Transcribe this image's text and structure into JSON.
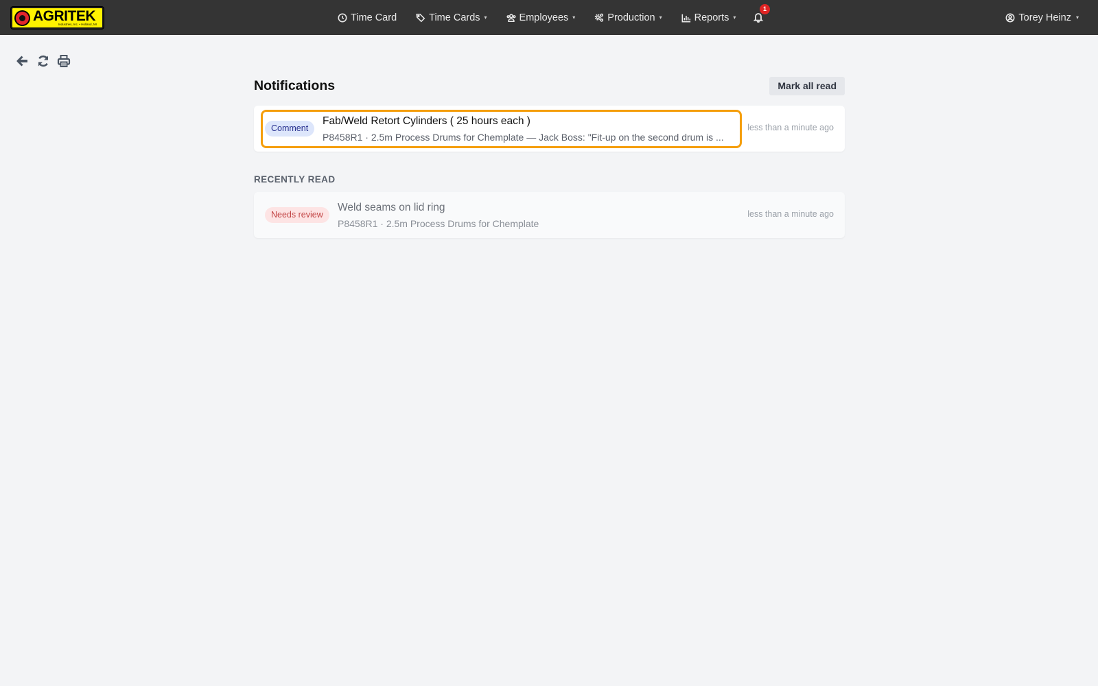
{
  "brand": {
    "logo_text": "AGRITEK",
    "logo_subtext": "Industries, Inc. • Holland, MI",
    "logo_bg": "#fff200"
  },
  "nav": {
    "items": [
      {
        "label": "Time Card",
        "icon": "clock-icon",
        "has_dropdown": false
      },
      {
        "label": "Time Cards",
        "icon": "tags-icon",
        "has_dropdown": true
      },
      {
        "label": "Employees",
        "icon": "users-icon",
        "has_dropdown": true
      },
      {
        "label": "Production",
        "icon": "gears-icon",
        "has_dropdown": true
      },
      {
        "label": "Reports",
        "icon": "bar-chart-icon",
        "has_dropdown": true
      }
    ],
    "caret": "▾",
    "notifications_count": "1",
    "user_name": "Torey Heinz"
  },
  "toolbar": {
    "icons": [
      "back-arrow-icon",
      "refresh-icon",
      "print-icon"
    ]
  },
  "page": {
    "title": "Notifications",
    "mark_all_read_label": "Mark all read"
  },
  "unread": [
    {
      "badge": "Comment",
      "title": "Fab/Weld Retort Cylinders ( 25 hours each )",
      "subtitle": "P8458R1 · 2.5m Process Drums for Chemplate — Jack Boss: \"Fit-up on the second drum is ...",
      "time": "less than a minute ago"
    }
  ],
  "recently_read_label": "RECENTLY READ",
  "read": [
    {
      "badge": "Needs review",
      "title": "Weld seams on lid ring",
      "subtitle": "P8458R1 · 2.5m Process Drums for Chemplate",
      "time": "less than a minute ago"
    }
  ],
  "colors": {
    "navbar_bg": "#343434",
    "page_bg": "#f3f4f6",
    "highlight": "#f59e0b",
    "badge_comment_bg": "#dde6fb",
    "badge_review_bg": "#fde4e4",
    "notification_badge": "#e02424"
  }
}
